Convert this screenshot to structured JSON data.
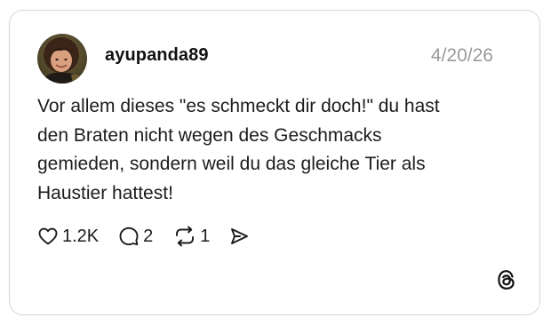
{
  "post": {
    "username": "ayupanda89",
    "date": "4/20/26",
    "lines": [
      "Vor allem dieses \"es schmeckt dir doch!\" du hast",
      "den Braten nicht wegen des Geschmacks",
      "gemieden, sondern weil du das gleiche Tier als",
      "Haustier hattest!"
    ]
  },
  "actions": {
    "likes": "1.2K",
    "replies": "2",
    "reposts": "1"
  },
  "icons": {
    "like": "heart-icon",
    "reply": "speech-bubble-icon",
    "repost": "repost-arrows-icon",
    "share": "send-icon",
    "brand": "threads-logo-icon"
  },
  "colors": {
    "text": "#1c1c1c",
    "muted": "#9a9a9a",
    "border": "#d6d6d6"
  }
}
